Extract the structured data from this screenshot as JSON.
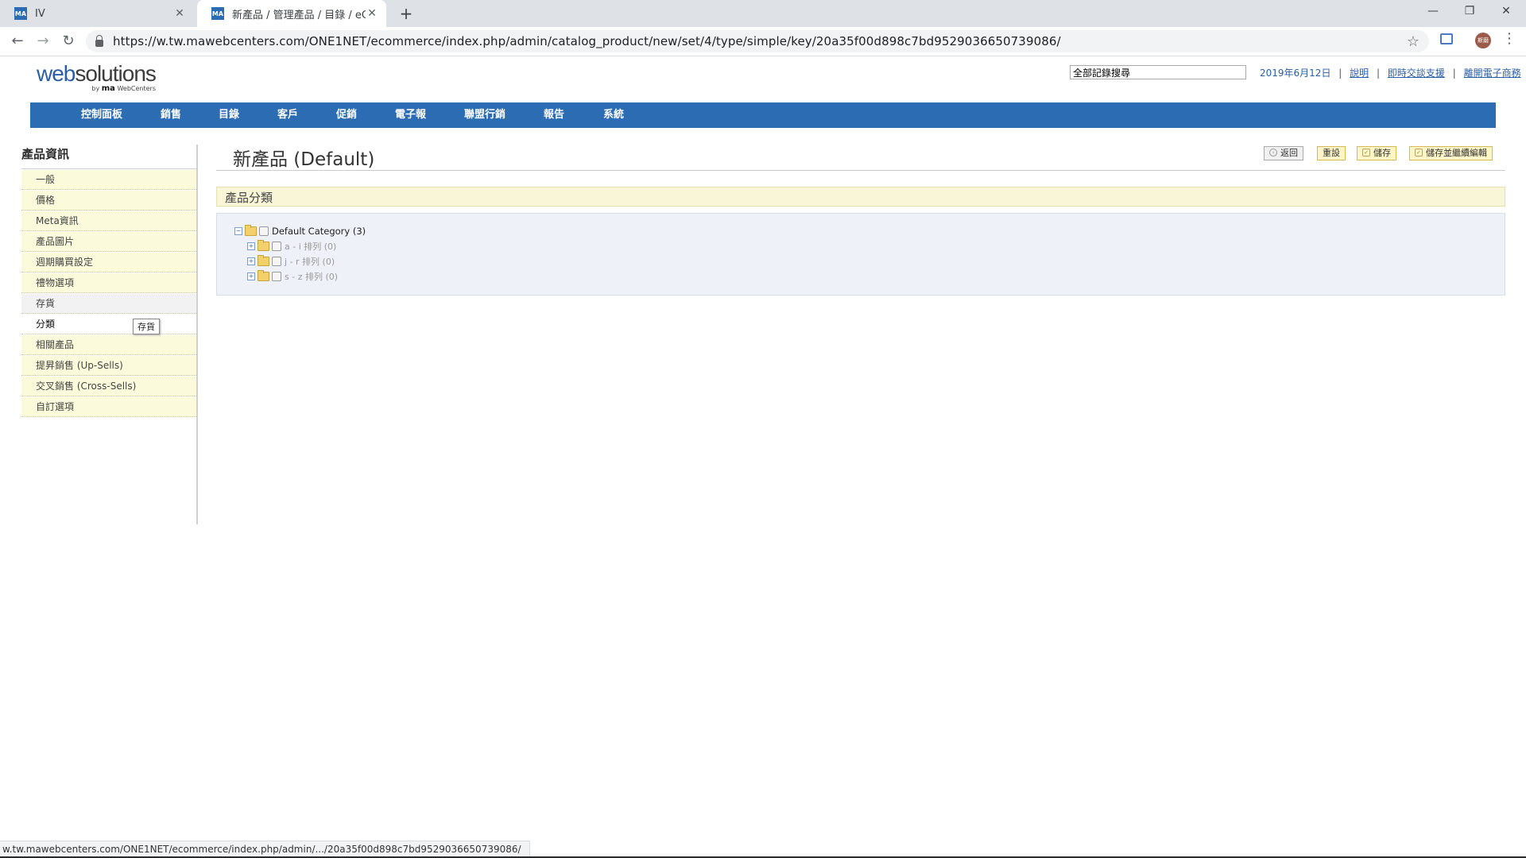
{
  "browser": {
    "tabs": [
      {
        "favicon": "MA",
        "title": "IV"
      },
      {
        "favicon": "MA",
        "title": "新產品 / 管理產品 / 目錄 / eCom"
      }
    ],
    "url": "https://w.tw.mawebcenters.com/ONE1NET/ecommerce/index.php/admin/catalog_product/new/set/4/type/simple/key/20a35f00d898c7bd9529036650739086/",
    "profile_initials": "斯磨",
    "status_url": "w.tw.mawebcenters.com/ONE1NET/ecommerce/index.php/admin/.../20a35f00d898c7bd9529036650739086/"
  },
  "header": {
    "logo_web": "web",
    "logo_solutions": "solutions",
    "logo_by": "by",
    "logo_ma": "ma",
    "logo_webcenters": "WebCenters",
    "search_value": "全部記錄搜尋",
    "date": "2019年6月12日",
    "links": [
      "說明",
      "即時交談支援",
      "離開電子商務"
    ]
  },
  "nav": [
    "控制面板",
    "銷售",
    "目錄",
    "客戶",
    "促銷",
    "電子報",
    "聯盟行銷",
    "報告",
    "系統"
  ],
  "sidebar": {
    "title": "產品資訊",
    "items": [
      "一般",
      "價格",
      "Meta資訊",
      "產品圖片",
      "週期購買設定",
      "禮物選項",
      "存貨",
      "分類",
      "相關產品",
      "提昇銷售 (Up-Sells)",
      "交叉銷售 (Cross-Sells)",
      "自訂選項"
    ],
    "tooltip": "存貨"
  },
  "content": {
    "title": "新產品 (Default)",
    "buttons": {
      "back": "返回",
      "reset": "重設",
      "save": "儲存",
      "save_continue": "儲存並繼續編輯"
    },
    "section_title": "產品分類",
    "tree": {
      "root": "Default Category (3)",
      "children": [
        "a - i 排列 (0)",
        "j - r 排列 (0)",
        "s - z 排列 (0)"
      ]
    }
  },
  "colors": {
    "nav_bg": "#2b6cb3",
    "sidebar_item_bg": "#fbfbdc",
    "section_bg": "#f8f6d6",
    "tree_bg": "#eef1f8"
  }
}
